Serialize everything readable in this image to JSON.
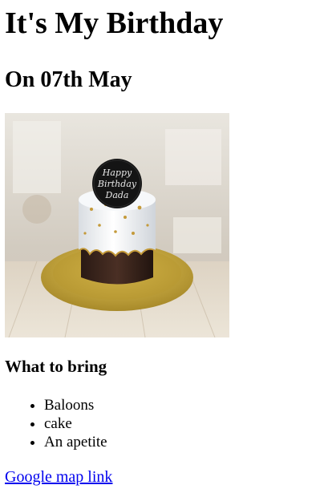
{
  "page": {
    "title": "It's My Birthday",
    "subtitle": "On 07th May",
    "cake_topper_text": "Happy Birthday Dada",
    "bring_heading": "What to bring",
    "bring_items": [
      "Baloons",
      "cake",
      "An apetite"
    ],
    "map_link_label": "Google map link"
  }
}
